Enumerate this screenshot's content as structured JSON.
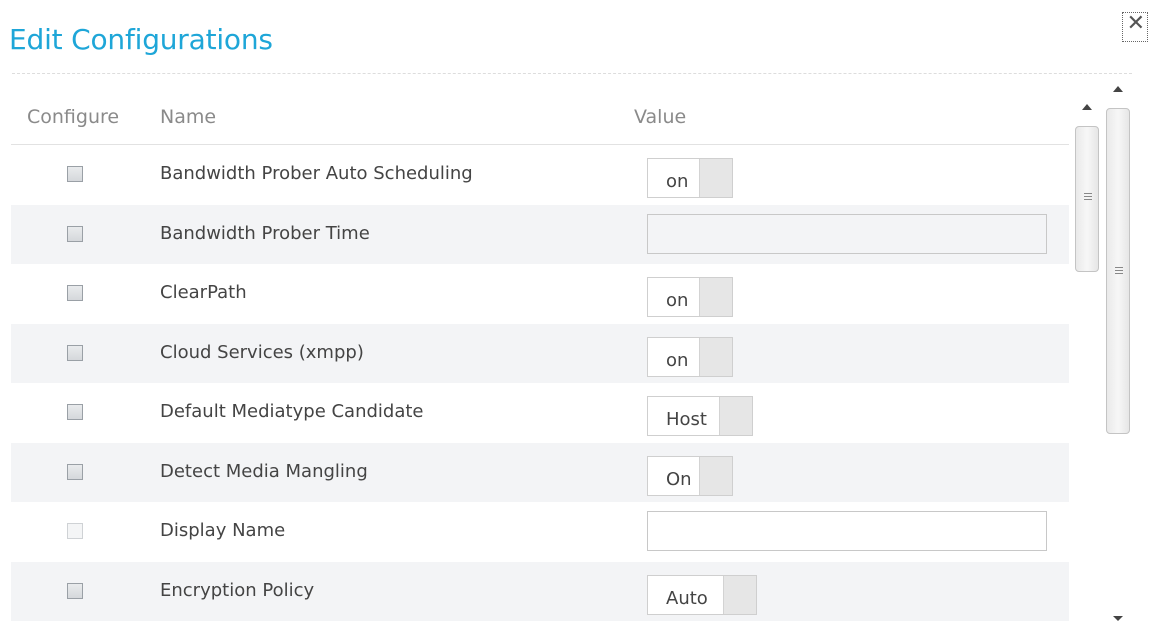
{
  "dialog": {
    "title": "Edit Configurations",
    "close_icon": "close-icon",
    "close_glyph": "✕"
  },
  "table": {
    "headers": {
      "configure": "Configure",
      "name": "Name",
      "value": "Value"
    },
    "rows": [
      {
        "name": "Bandwidth Prober Auto Scheduling",
        "control": "toggle",
        "value": "on",
        "checkbox_enabled": true
      },
      {
        "name": "Bandwidth Prober Time",
        "control": "text-readonly",
        "value": "",
        "checkbox_enabled": true
      },
      {
        "name": "ClearPath",
        "control": "toggle",
        "value": "on",
        "checkbox_enabled": true
      },
      {
        "name": "Cloud Services (xmpp)",
        "control": "toggle",
        "value": "on",
        "checkbox_enabled": true
      },
      {
        "name": "Default Mediatype Candidate",
        "control": "toggle",
        "value": "Host",
        "checkbox_enabled": true
      },
      {
        "name": "Detect Media Mangling",
        "control": "toggle",
        "value": "On",
        "checkbox_enabled": true
      },
      {
        "name": "Display Name",
        "control": "text",
        "value": "",
        "checkbox_enabled": false
      },
      {
        "name": "Encryption Policy",
        "control": "toggle",
        "value": "Auto",
        "checkbox_enabled": true
      }
    ]
  },
  "colors": {
    "title": "#1ea6d8",
    "row_alt": "#f3f4f6",
    "header_text": "#8a8a8a",
    "body_text": "#444444"
  }
}
